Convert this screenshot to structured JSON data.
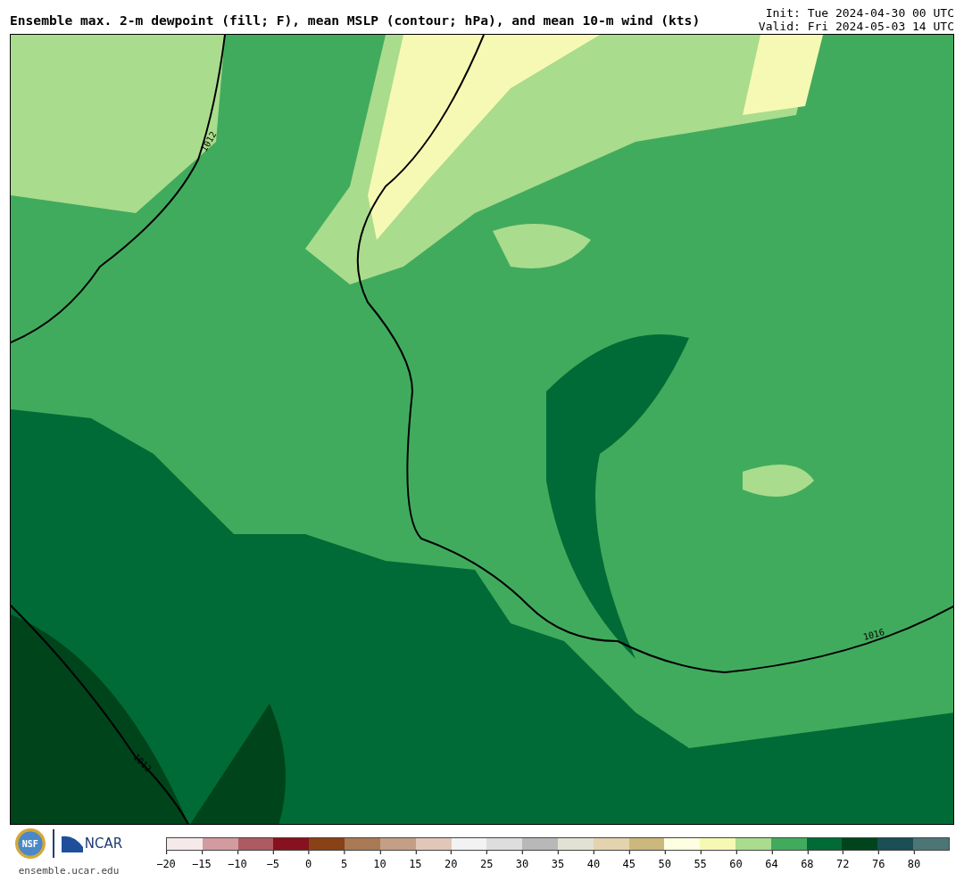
{
  "title": "Ensemble max. 2-m dewpoint (fill; F), mean MSLP (contour; hPa), and mean 10-m wind (kts)",
  "init": "Init: Tue 2024-04-30 00 UTC",
  "valid": "Valid: Fri 2024-05-03 14 UTC",
  "map": {
    "contour_labels": [
      "1012",
      "1012",
      "1016"
    ]
  },
  "logos": {
    "nsf": "NSF",
    "ncar": "NCAR",
    "site": "ensemble.ucar.edu"
  },
  "colorbar": {
    "bins": [
      {
        "color": "#f5e9e9"
      },
      {
        "color": "#d19ba0"
      },
      {
        "color": "#ae5a62"
      },
      {
        "color": "#87111e"
      },
      {
        "color": "#884215"
      },
      {
        "color": "#a87a56"
      },
      {
        "color": "#c39f86"
      },
      {
        "color": "#e0c7b7"
      },
      {
        "color": "#f2f2f2"
      },
      {
        "color": "#dddddd"
      },
      {
        "color": "#b8b8b8"
      },
      {
        "color": "#e1e2d3"
      },
      {
        "color": "#e3d3ae"
      },
      {
        "color": "#ccb87c"
      },
      {
        "color": "#fefee2"
      },
      {
        "color": "#f6f9b4"
      },
      {
        "color": "#aadc8d"
      },
      {
        "color": "#41ab5d"
      },
      {
        "color": "#006b36"
      },
      {
        "color": "#00441b"
      },
      {
        "color": "#1b4e55"
      },
      {
        "color": "#4c7575"
      }
    ],
    "ticks": [
      "−20",
      "−15",
      "−10",
      "−5",
      "0",
      "5",
      "10",
      "15",
      "20",
      "25",
      "30",
      "35",
      "40",
      "45",
      "50",
      "55",
      "60",
      "64",
      "68",
      "72",
      "76",
      "80"
    ]
  }
}
